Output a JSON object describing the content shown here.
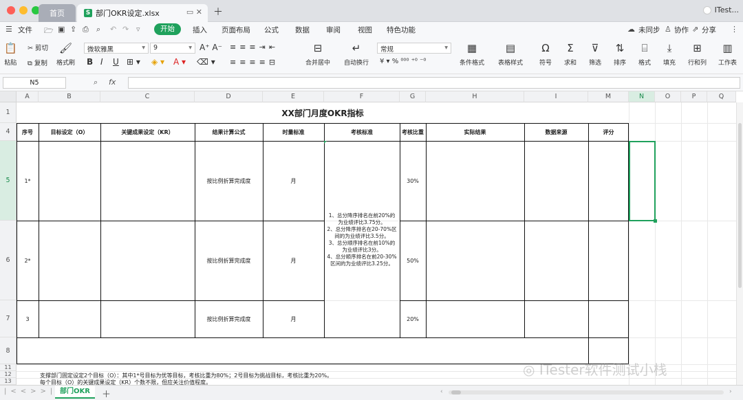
{
  "window": {
    "tabs": [
      {
        "label": "首页"
      },
      {
        "label": "部门OKR设定.xlsx"
      }
    ],
    "user": "ITest..."
  },
  "menu": {
    "file": "文件",
    "items": [
      "开始",
      "插入",
      "页面布局",
      "公式",
      "数据",
      "审阅",
      "视图",
      "特色功能"
    ],
    "right": [
      "未同步",
      "协作",
      "分享"
    ]
  },
  "ribbon": {
    "cut": "剪切",
    "paste": "粘贴",
    "copy": "复制",
    "format_painter": "格式刷",
    "font_name": "微软雅黑",
    "font_size": "9",
    "merge_center": "合并居中",
    "wrap_text": "自动换行",
    "number_format": "常规",
    "cond_format": "条件格式",
    "table_style": "表格样式",
    "symbol": "符号",
    "sum": "求和",
    "filter": "筛选",
    "sort": "排序",
    "format": "格式",
    "fill": "填充",
    "rowcol": "行和列",
    "worksheet": "工作表"
  },
  "formula_bar": {
    "name_box": "N5",
    "fx": "fx",
    "value": ""
  },
  "columns": [
    "A",
    "B",
    "C",
    "D",
    "E",
    "F",
    "G",
    "H",
    "I",
    "M",
    "N",
    "O",
    "P",
    "Q"
  ],
  "rows": [
    "1",
    "4",
    "5",
    "6",
    "7",
    "8",
    "11",
    "12",
    "13"
  ],
  "sheet": {
    "title": "XX部门月度OKR指标",
    "headers": [
      "序号",
      "目标设定（O）",
      "关键成果设定（KR）",
      "结果计算公式",
      "时量标准",
      "考核标准",
      "考核比重",
      "实际结果",
      "数据来源",
      "评分"
    ],
    "data_rows": [
      {
        "seq": "1*",
        "formula": "按比例折算完成度",
        "period": "月",
        "weight": "30%"
      },
      {
        "seq": "2*",
        "formula": "按比例折算完成度",
        "period": "月",
        "weight": "50%"
      },
      {
        "seq": "3",
        "formula": "按比例折算完成度",
        "period": "月",
        "weight": "20%"
      }
    ],
    "criteria": [
      "1、总分降序排名在前20%的为业绩评比3.75分。",
      "2、总分降序排名在20-70%区间的为业绩评比3.5分。",
      "3、总分顺序排名在前10%的为业绩评比3分。",
      "4、总分顺序排名在前20-30%区间的为业绩评比3.25分。"
    ],
    "notes": [
      "支撑部门固定设定2个目标（O）：其中1*号目标为优等目标，考核比重为80%；2号目标为挑战目标，考核比重为20%。",
      "每个目标（O）的关键成果设定（KR）个数不限，但应关注价值程度。"
    ]
  },
  "status": {
    "sheet_tab": "部门OKR"
  },
  "watermark": "ITester软件测试小栈"
}
